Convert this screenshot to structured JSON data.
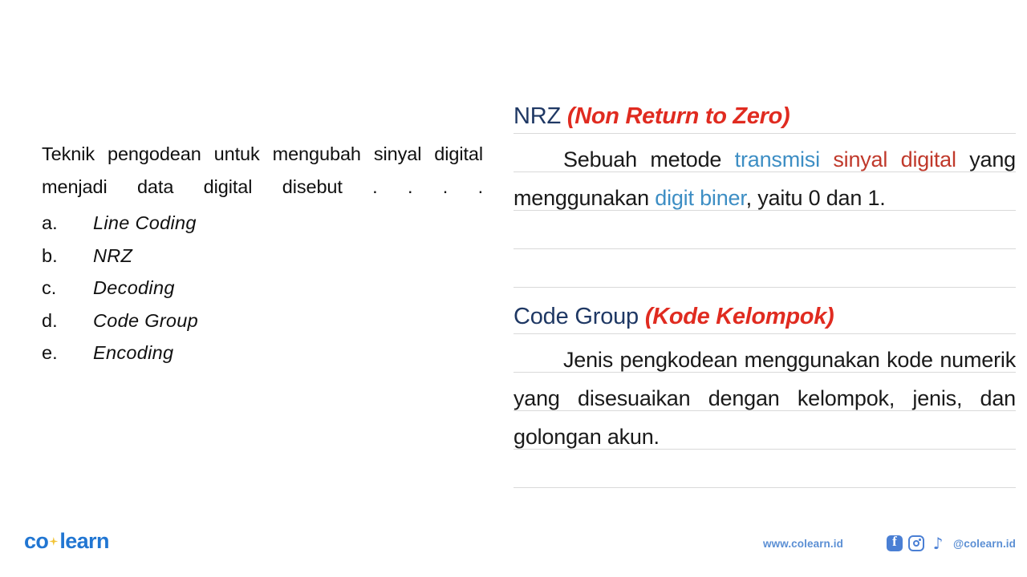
{
  "question": {
    "stem": "Teknik pengodean untuk mengubah sinyal digital menjadi data digital disebut . . . .",
    "options": [
      {
        "marker": "a.",
        "text": "Line Coding"
      },
      {
        "marker": "b.",
        "text": "NRZ"
      },
      {
        "marker": "c.",
        "text": "Decoding"
      },
      {
        "marker": "d.",
        "text": "Code Group"
      },
      {
        "marker": "e.",
        "text": "Encoding"
      }
    ]
  },
  "explanation": {
    "sections": [
      {
        "term": "NRZ ",
        "gloss": "(Non Return to Zero)",
        "body": {
          "part1": "Sebuah metode ",
          "kw1": "transmisi ",
          "kw2": "sinyal digital",
          "part2": " yang menggunakan ",
          "kw3": "digit biner",
          "part3": ", yaitu 0 dan 1."
        }
      },
      {
        "term": "Code Group ",
        "gloss": "(Kode Kelompok)",
        "body": {
          "full": "Jenis pengkodean menggunakan kode numerik yang disesuaikan dengan kelompok, jenis, dan golongan akun."
        }
      }
    ]
  },
  "footer": {
    "logo_co": "co",
    "logo_learn": "learn",
    "website": "www.colearn.id",
    "handle": "@colearn.id",
    "tiktok_glyph": "♪"
  },
  "colors": {
    "heading_navy": "#1F3864",
    "gloss_red": "#E02B20",
    "keyword_blue": "#3D8EC4",
    "keyword_red": "#C0392B",
    "brand_blue": "#2176D2",
    "footer_blue": "#5B8FD4",
    "rule_gray": "#D9D9D9",
    "logo_star": "#F2C335"
  }
}
